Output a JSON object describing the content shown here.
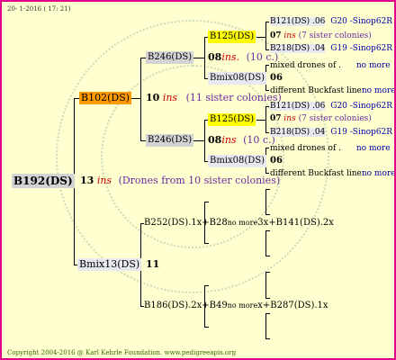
{
  "header": {
    "date": "20- 1-2016 ( 17: 21)"
  },
  "footer": {
    "copyright": "Copyright 2004-2016 @ Karl Kehrle Foundation.   www.pedigreeapis.org"
  },
  "pedigree": {
    "root": {
      "id": "B192(DS)"
    },
    "mothers_line": {
      "ins_count": "13",
      "ins_word": "ins",
      "note": "(Drones from 10 sister colonies)",
      "queen": "B102(DS)",
      "queen_ins_count": "10",
      "queen_ins_word": "ins",
      "queen_note": "(11 sister colonies)",
      "upper": {
        "queen": "B246(DS)",
        "ins_count": "08",
        "ins_word": "ins.",
        "note": "(10 c.)",
        "dam": "B125(DS)",
        "dam_ins": "07",
        "dam_ins_word": "ins",
        "dam_note": "(7 sister colonies)",
        "dam_parent_a": {
          "label": "B121(DS) .06",
          "code": "G20 -Sinop62R"
        },
        "dam_parent_b": {
          "label": "B218(DS) .04",
          "code": "G19 -Sinop62R"
        },
        "sire": "Bmix08(DS)",
        "sire_count": "06",
        "mixed": "mixed drones of .",
        "mixed_more": "no more",
        "buckfast": "different Buckfast line",
        "buckfast_more": "no more"
      },
      "lower": {
        "queen": "B246(DS)",
        "ins_count": "08",
        "ins_word": "ins",
        "note": "(10 c.)",
        "dam": "B125(DS)",
        "dam_ins": "07",
        "dam_ins_word": "ins",
        "dam_note": "(7 sister colonies)",
        "dam_parent_a": {
          "label": "B121(DS) .06",
          "code": "G20 -Sinop62R"
        },
        "dam_parent_b": {
          "label": "B218(DS) .04",
          "code": "G19 -Sinop62R"
        },
        "sire": "Bmix08(DS)",
        "sire_count": "06",
        "mixed": "mixed drones of .",
        "mixed_more": "no more",
        "buckfast": "different Buckfast line",
        "buckfast_more": "no more"
      }
    },
    "fathers_line": {
      "sire": "Bmix13(DS)",
      "count": "11",
      "upper": {
        "pre": "B252(DS).1x+B28",
        "mid": "no more",
        "post": "3x+B141(DS).2x"
      },
      "lower": {
        "pre": "B186(DS).2x+B49",
        "mid": "no more",
        "post": "x+B287(DS).1x"
      }
    }
  },
  "colors": {
    "frame": "#e0008a",
    "background": "#ffffd0",
    "queen_orange": "#ff9900",
    "queen_yellow": "#ffff00",
    "ins": "#cc0000"
  }
}
